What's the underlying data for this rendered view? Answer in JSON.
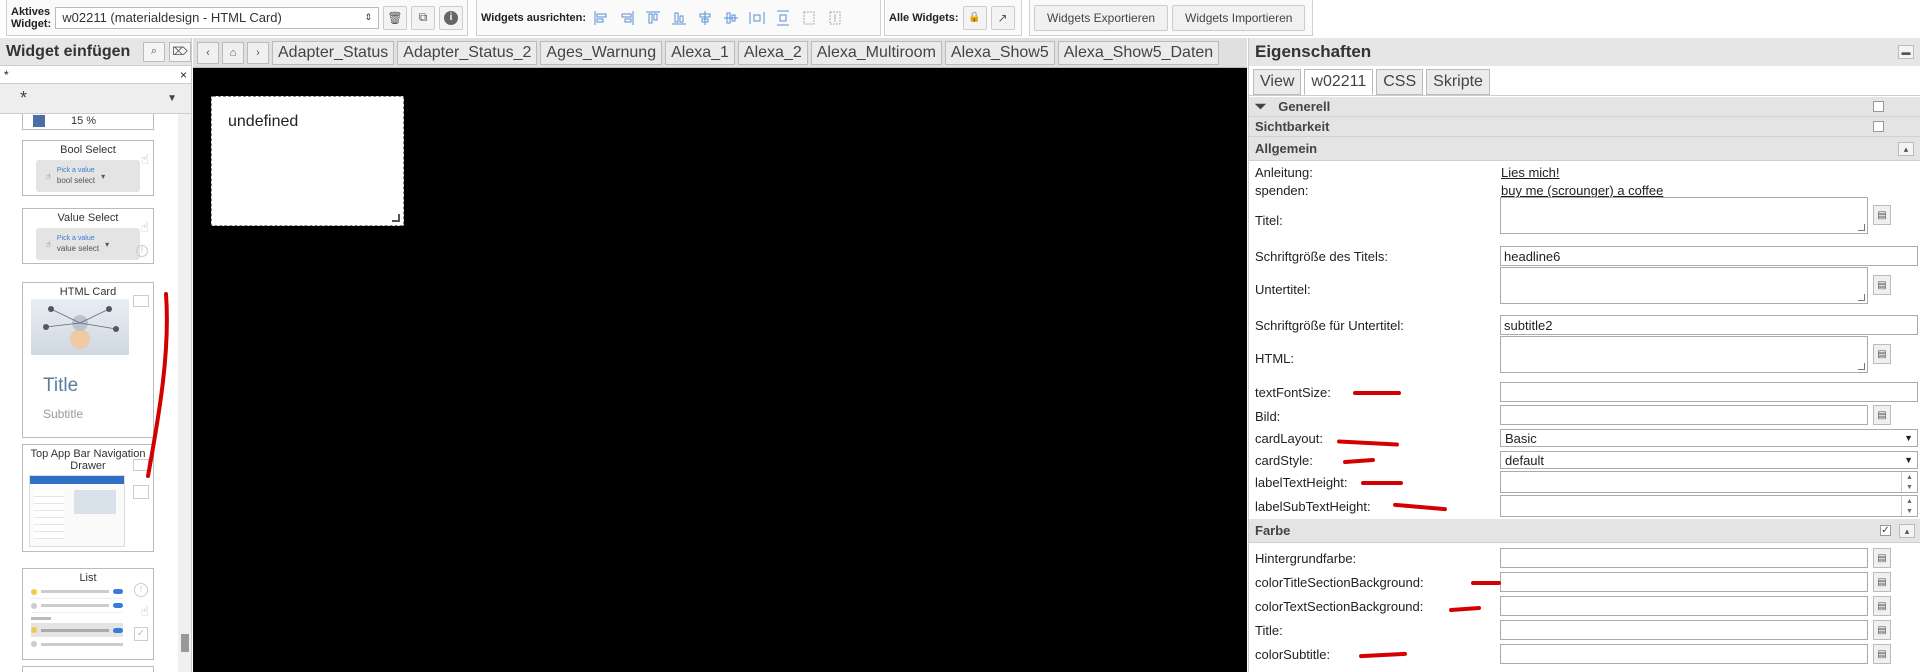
{
  "toolbar": {
    "active_widget_label": "Aktives\nWidget:",
    "active_widget_line1": "Aktives",
    "active_widget_line2": "Widget:",
    "active_widget_value": "w02211 (materialdesign - HTML Card)",
    "align_label": "Widgets ausrichten:",
    "all_widgets_label": "Alle Widgets:",
    "export_label": "Widgets Exportieren",
    "import_label": "Widgets Importieren"
  },
  "left_panel": {
    "title": "Widget einfügen",
    "filter_value": "*",
    "filter_clear": "×",
    "set_value": "*",
    "items": {
      "partial_value": "15 %",
      "bool_select": {
        "title": "Bool Select",
        "hint": "Pick a value",
        "value": "bool select"
      },
      "value_select": {
        "title": "Value Select",
        "hint": "Pick a value",
        "value": "value select"
      },
      "html_card": {
        "title": "HTML Card",
        "card_title": "Title",
        "card_subtitle": "Subtitle"
      },
      "top_app_bar": {
        "title": "Top App Bar Navigation Drawer"
      },
      "list": {
        "title": "List"
      }
    }
  },
  "views": {
    "tabs": [
      "Adapter_Status",
      "Adapter_Status_2",
      "Ages_Warnung",
      "Alexa_1",
      "Alexa_2",
      "Alexa_Multiroom",
      "Alexa_Show5",
      "Alexa_Show5_Daten"
    ]
  },
  "canvas": {
    "widget_text": "undefined"
  },
  "properties": {
    "title": "Eigenschaften",
    "tabs": [
      "View",
      "w02211",
      "CSS",
      "Skripte"
    ],
    "sections": {
      "generell": "Generell",
      "sichtbarkeit": "Sichtbarkeit",
      "allgemein": "Allgemein",
      "farbe": "Farbe"
    },
    "rows": {
      "anleitung_label": "Anleitung:",
      "anleitung_link": "Lies mich!",
      "spenden_label": "spenden:",
      "spenden_link": "buy me (scrounger) a coffee",
      "titel_label": "Titel:",
      "titel_font_label": "Schriftgröße des Titels:",
      "titel_font_value": "headline6",
      "untertitel_label": "Untertitel:",
      "untertitel_font_label": "Schriftgröße für Untertitel:",
      "untertitel_font_value": "subtitle2",
      "html_label": "HTML:",
      "text_font_size_label": "textFontSize:",
      "bild_label": "Bild:",
      "card_layout_label": "cardLayout:",
      "card_layout_value": "Basic",
      "card_style_label": "cardStyle:",
      "card_style_value": "default",
      "label_text_height_label": "labelTextHeight:",
      "label_sub_text_height_label": "labelSubTextHeight:",
      "hintergrund_label": "Hintergrundfarbe:",
      "color_title_bg_label": "colorTitleSectionBackground:",
      "color_text_bg_label": "colorTextSectionBackground:",
      "title_color_label": "Title:",
      "color_subtitle_label": "colorSubtitle:"
    }
  },
  "colors": {
    "annotation_red": "#d40000",
    "canvas_bg": "#000000",
    "panel_header": "#e6e6e6"
  }
}
